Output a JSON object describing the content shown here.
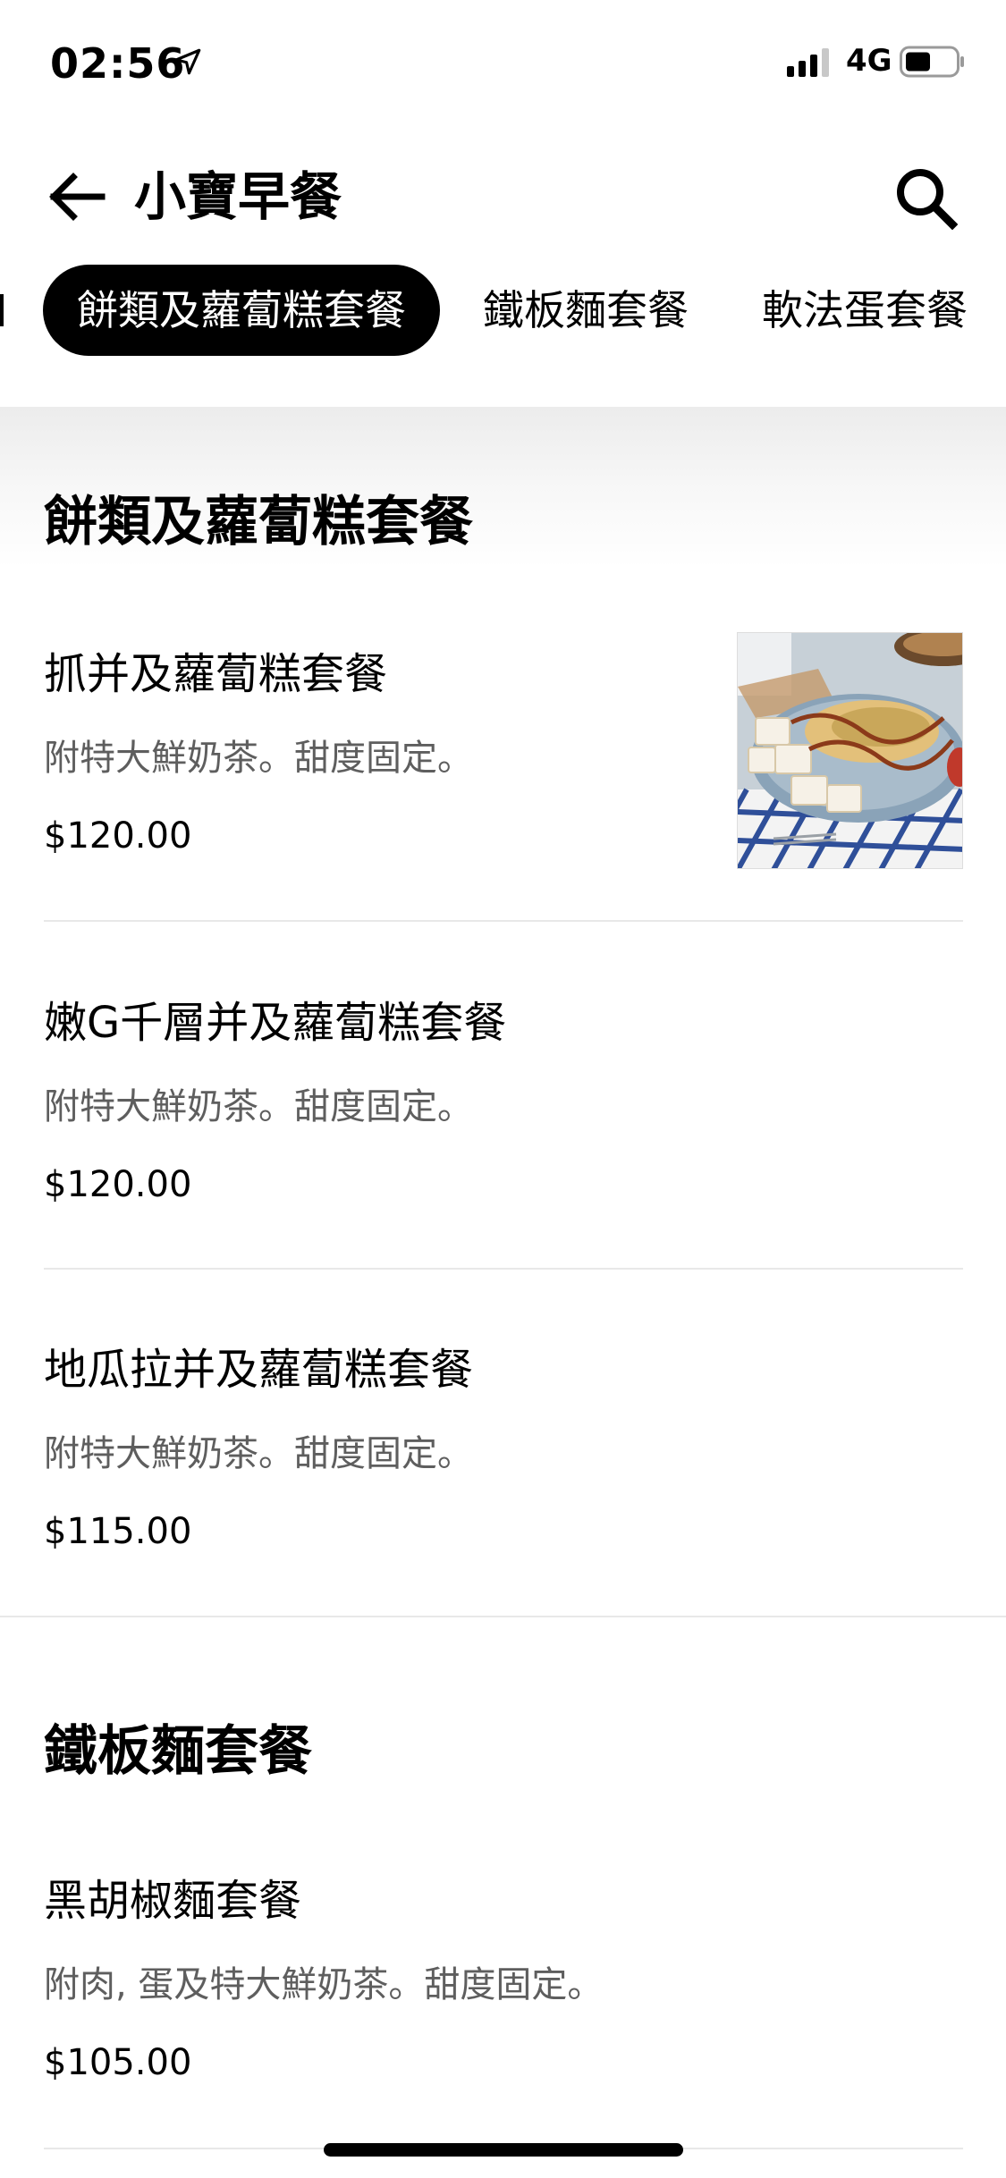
{
  "status_bar": {
    "time": "02:56",
    "network": "4G"
  },
  "header": {
    "title": "小寶早餐"
  },
  "tabs": [
    {
      "label": "餅類及蘿蔔糕套餐",
      "active": true
    },
    {
      "label": "鐵板麵套餐",
      "active": false
    },
    {
      "label": "軟法蛋套餐",
      "active": false
    }
  ],
  "sections": [
    {
      "title": "餅類及蘿蔔糕套餐",
      "items": [
        {
          "name": "抓并及蘿蔔糕套餐",
          "description": "附特大鮮奶茶。甜度固定。",
          "price": "$120.00",
          "has_photo": true
        },
        {
          "name": "嫩G千層并及蘿蔔糕套餐",
          "description": "附特大鮮奶茶。甜度固定。",
          "price": "$120.00",
          "has_photo": false
        },
        {
          "name": "地瓜拉并及蘿蔔糕套餐",
          "description": "附特大鮮奶茶。甜度固定。",
          "price": "$115.00",
          "has_photo": false
        }
      ]
    },
    {
      "title": "鐵板麵套餐",
      "items": [
        {
          "name": "黑胡椒麵套餐",
          "description": "附肉, 蛋及特大鮮奶茶。甜度固定。",
          "price": "$105.00",
          "has_photo": false
        }
      ]
    }
  ]
}
